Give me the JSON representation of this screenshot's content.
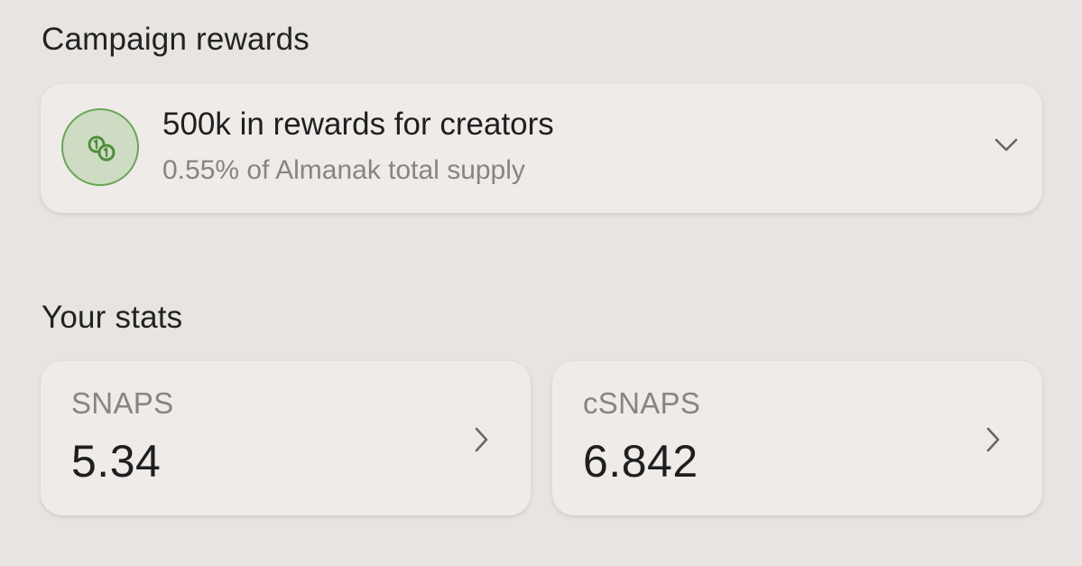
{
  "campaign_section": {
    "title": "Campaign rewards"
  },
  "reward_card": {
    "icon": "coins-icon",
    "title": "500k in rewards for creators",
    "subtitle": "0.55% of Almanak total supply",
    "expand_icon": "chevron-down-icon"
  },
  "stats_section": {
    "title": "Your stats",
    "cards": [
      {
        "label": "SNAPS",
        "value": "5.34",
        "icon": "chevron-right-icon"
      },
      {
        "label": "cSNAPS",
        "value": "6.842",
        "icon": "chevron-right-icon"
      }
    ]
  },
  "colors": {
    "background": "#e7e4e1",
    "card": "#eeebe9",
    "accent_green": "#6aa556",
    "accent_green_fill": "#cfdcc4",
    "muted_text": "#8a8480"
  }
}
